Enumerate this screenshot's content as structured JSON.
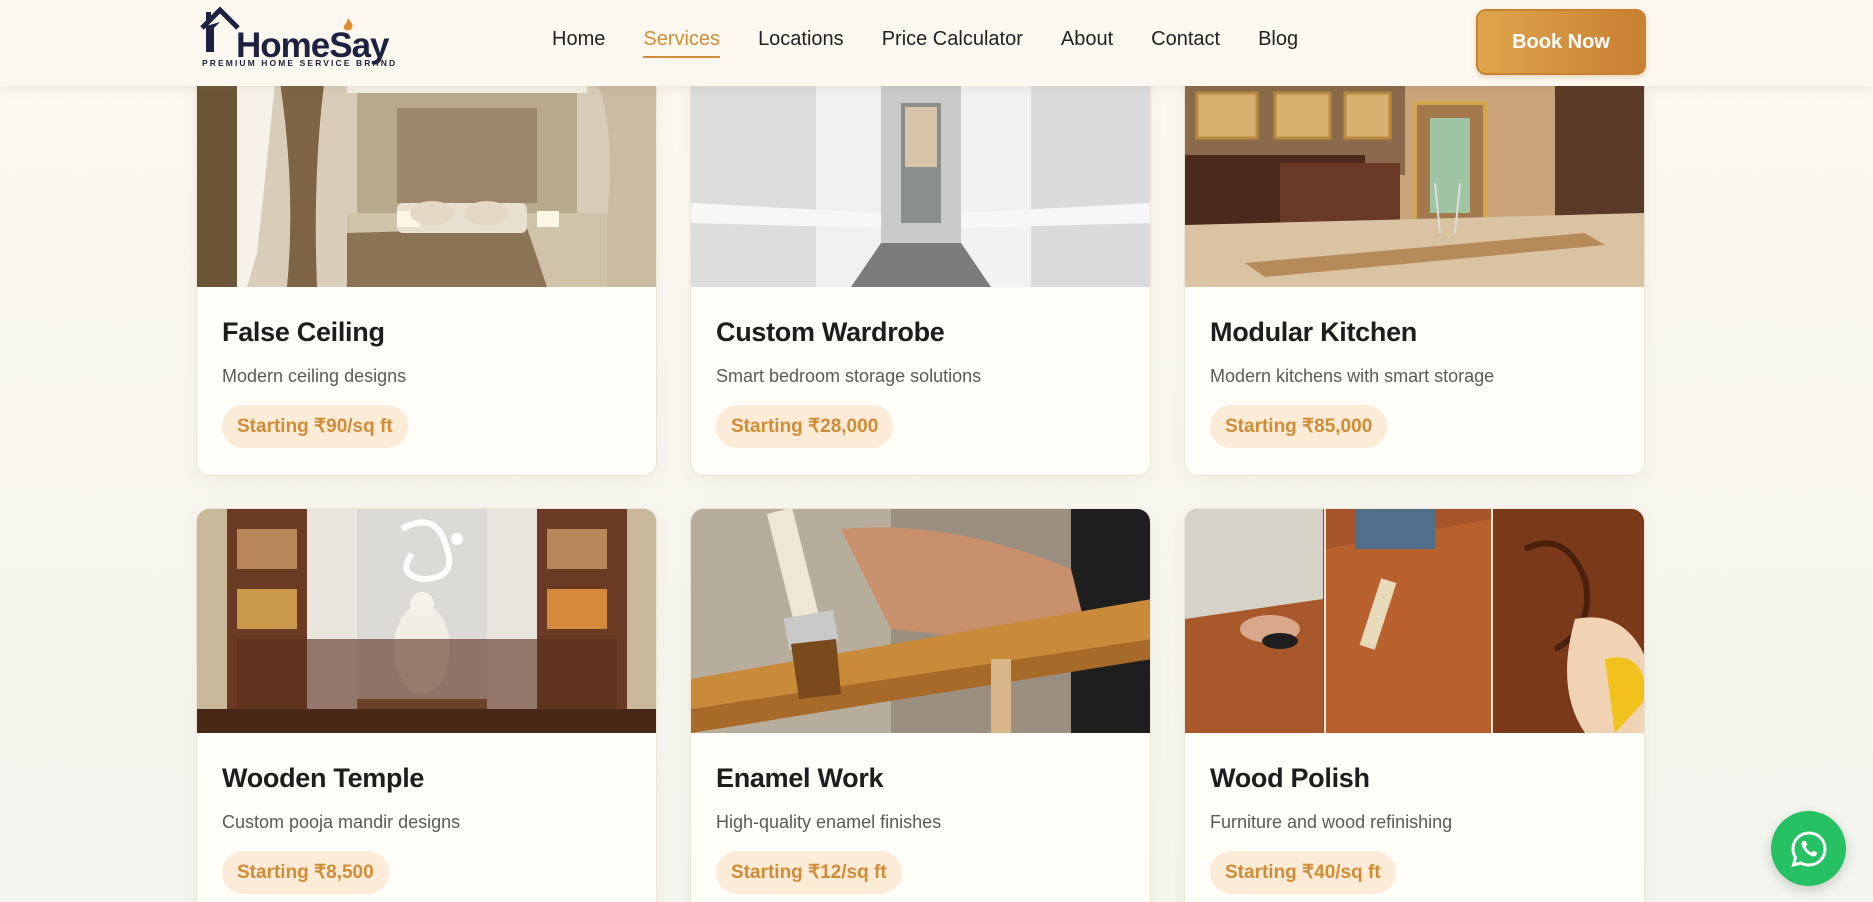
{
  "brand": {
    "name": "HomeSay",
    "tagline": "PREMIUM HOME SERVICE BRAND"
  },
  "nav": {
    "items": [
      {
        "label": "Home"
      },
      {
        "label": "Services",
        "active": true
      },
      {
        "label": "Locations"
      },
      {
        "label": "Price Calculator"
      },
      {
        "label": "About"
      },
      {
        "label": "Contact"
      },
      {
        "label": "Blog"
      }
    ],
    "cta": "Book Now"
  },
  "services": [
    {
      "title": "False Ceiling",
      "description": "Modern ceiling designs",
      "price": "Starting ₹90/sq ft",
      "image_icon": "bedroom-ceiling-photo"
    },
    {
      "title": "Custom Wardrobe",
      "description": "Smart bedroom storage solutions",
      "price": "Starting ₹28,000",
      "image_icon": "wardrobe-photo"
    },
    {
      "title": "Modular Kitchen",
      "description": "Modern kitchens with smart storage",
      "price": "Starting ₹85,000",
      "image_icon": "kitchen-photo"
    },
    {
      "title": "Wooden Temple",
      "description": "Custom pooja mandir designs",
      "price": "Starting ₹8,500",
      "image_icon": "temple-photo"
    },
    {
      "title": "Enamel Work",
      "description": "High-quality enamel finishes",
      "price": "Starting ₹12/sq ft",
      "image_icon": "paint-brush-photo"
    },
    {
      "title": "Wood Polish",
      "description": "Furniture and wood refinishing",
      "price": "Starting ₹40/sq ft",
      "image_icon": "wood-polish-photo"
    }
  ],
  "colors": {
    "accent": "#d08c36",
    "brand_navy": "#1c2240",
    "whatsapp": "#26c162"
  },
  "floating": {
    "icon": "whatsapp-icon"
  }
}
